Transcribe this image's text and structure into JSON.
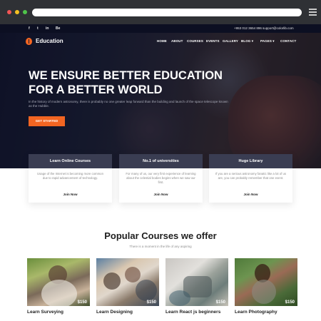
{
  "browser": {
    "icons": [
      "close-dot",
      "minimize-dot",
      "maximize-dot",
      "menu-icon"
    ]
  },
  "topbar": {
    "social": [
      "f",
      "t",
      "in",
      "Be"
    ],
    "phone": "+953 012 3654 896",
    "email": "support@colorlib.com"
  },
  "nav": {
    "logo": "Education",
    "items": [
      "HOME",
      "ABOUT",
      "COURSES",
      "EVENTS",
      "GALLERY",
      "BLOG ▾",
      "PAGES ▾",
      "CONTACT"
    ]
  },
  "hero": {
    "title_line1": "WE ENSURE BETTER EDUCATION",
    "title_line2": "FOR A BETTER WORLD",
    "subtitle": "In the history of modern astronomy, there is probably no one greater leap forward than the building and launch of the space telescope known as the Hubble.",
    "cta": "GET STARTED"
  },
  "features": [
    {
      "title": "Learn Online Courses",
      "text": "Usage of the Internet is becoming more common due to rapid advancement of technology.",
      "link": "Join Now"
    },
    {
      "title": "No.1 of universities",
      "text": "For many of us, our very first experience of learning about the celestial bodies begins when we saw our first.",
      "link": "Join Now"
    },
    {
      "title": "Huge Library",
      "text": "If you are a serious astronomy fanatic like a lot of us are, you can probably remember that one event.",
      "link": "Join Now"
    }
  ],
  "courses_section": {
    "title": "Popular Courses we offer",
    "subtitle": "There is a moment in the life of any aspiring"
  },
  "courses": [
    {
      "title": "Learn Surveying",
      "price": "$150"
    },
    {
      "title": "Learn Designing",
      "price": "$150"
    },
    {
      "title": "Learn React js beginners",
      "price": "$150"
    },
    {
      "title": "Learn Photography",
      "price": "$150"
    }
  ],
  "colors": {
    "accent": "#f26522",
    "dark": "#0c0f22",
    "feature_head": "#3a3d52"
  }
}
